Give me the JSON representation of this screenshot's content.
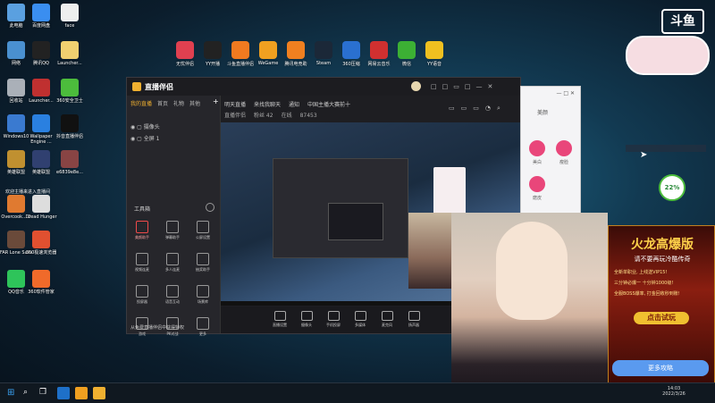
{
  "desktop_icons": [
    {
      "label": "此电脑",
      "color": "#5aa0e0"
    },
    {
      "label": "百度网盘",
      "color": "#3a8ef0"
    },
    {
      "label": "face",
      "color": "#eeeeee"
    },
    {
      "label": "网络",
      "color": "#4a90d0"
    },
    {
      "label": "腾讯QQ",
      "color": "#222222"
    },
    {
      "label": "Launcher...",
      "color": "#f0d070"
    },
    {
      "label": "回收站",
      "color": "#aab0b8"
    },
    {
      "label": "Launcher...",
      "color": "#c03030"
    },
    {
      "label": "360安全卫士",
      "color": "#4cbc3c"
    },
    {
      "label": "Windows10",
      "color": "#3a7ad0"
    },
    {
      "label": "Wallpaper Engine ...",
      "color": "#2a80e0"
    },
    {
      "label": "抖音直播伴侣",
      "color": "#111111"
    },
    {
      "label": "英雄联盟",
      "color": "#c09030"
    },
    {
      "label": "英雄联盟",
      "color": "#304070"
    },
    {
      "label": "e6839e8e...",
      "color": "#884444"
    },
    {
      "label": "Overcook... 2",
      "color": "#e07a30"
    },
    {
      "label": "Dread Hunger",
      "color": "#dddddd"
    },
    {
      "label": "FAR Lone Sails",
      "color": "#6a4a3a"
    },
    {
      "label": "360极速浏览器",
      "color": "#e05030"
    },
    {
      "label": "QQ音乐",
      "color": "#2ec45a"
    },
    {
      "label": "360软件管家",
      "color": "#f06a2a"
    }
  ],
  "desktop_note": "欢迎主播来进入直播间",
  "top_apps": [
    {
      "label": "无忧伴侣",
      "color": "#e04050"
    },
    {
      "label": "YY开播",
      "color": "#222222"
    },
    {
      "label": "斗鱼直播伴侣",
      "color": "#f07a20"
    },
    {
      "label": "WeGame",
      "color": "#f0a020"
    },
    {
      "label": "腾讯电竞助",
      "color": "#f08020"
    },
    {
      "label": "Steam",
      "color": "#1b2838"
    },
    {
      "label": "360压缩",
      "color": "#2a70d0"
    },
    {
      "label": "网易云音乐",
      "color": "#d03030"
    },
    {
      "label": "微信",
      "color": "#3cb034"
    },
    {
      "label": "YY语音",
      "color": "#f0c020"
    }
  ],
  "corner_logo": "斗鱼",
  "window": {
    "app_title": "直播伴侣",
    "left_tabs": [
      "我的直播",
      "首页",
      "礼物",
      "其他"
    ],
    "scenes": [
      {
        "label": "摄像头"
      },
      {
        "label": "全屏 1"
      }
    ],
    "toolbox_title": "工具箱",
    "tools": [
      {
        "label": "美颜助手"
      },
      {
        "label": "弹幕助手"
      },
      {
        "label": "公屏设置"
      },
      {
        "label": "视频连麦"
      },
      {
        "label": "多人连麦"
      },
      {
        "label": "抽奖助手"
      },
      {
        "label": "投屏器"
      },
      {
        "label": "语音互动"
      },
      {
        "label": "场景库"
      },
      {
        "label": "游戏"
      },
      {
        "label": "PK对战"
      },
      {
        "label": "更多"
      }
    ],
    "status_text": "从免费直播伴侣中获得特权",
    "header_line1": [
      "明天直播",
      "来找我聊天",
      "通知",
      "中国主播大赛前十"
    ],
    "header_line2": [
      "直播伴侣",
      "粉丝 42",
      "在线",
      "87453"
    ],
    "bottom_buttons": [
      "直播设置",
      "摄像头",
      "手机投屏",
      "多媒体",
      "麦克风",
      "扬声器"
    ]
  },
  "side_panel": {
    "title": "美颜",
    "items": [
      "美白",
      "瘦脸",
      "磨皮"
    ]
  },
  "badge_percent": "22%",
  "ad": {
    "title": "火龙高爆版",
    "subtitle": "请不要再玩冷酷传奇",
    "lines": [
      "全新单职业, 上线送VIP15!",
      "三分钟必爆一 十分钟1000级!",
      "全服BOSS爆率, 打金回收秒到账!"
    ],
    "cta": "点击试玩",
    "more_button": "更多攻略"
  },
  "clock": {
    "time": "14:03",
    "date": "2022/3/26"
  }
}
